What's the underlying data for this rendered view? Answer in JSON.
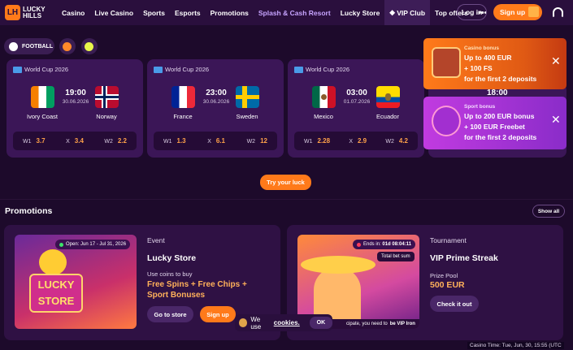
{
  "header": {
    "logo": {
      "mark": "LH",
      "line1": "LUCKY",
      "line2": "HILLS"
    },
    "nav": [
      "Casino",
      "Live Casino",
      "Sports",
      "Esports",
      "Promotions",
      "Splash & Cash Resort",
      "Lucky Store",
      "VIP Club",
      "Top offers"
    ],
    "more": "•••",
    "login": "Log in",
    "signup": "Sign up"
  },
  "sports": {
    "football": "FOOTBALL"
  },
  "matches": [
    {
      "league": "World Cup 2026",
      "time": "19:00",
      "date": "30.06.2026",
      "home": "Ivory Coast",
      "away": "Norway",
      "w1_label": "W1",
      "w1": "3.7",
      "x_label": "X",
      "x": "3.4",
      "w2_label": "W2",
      "w2": "2.2"
    },
    {
      "league": "World Cup 2026",
      "time": "23:00",
      "date": "30.06.2026",
      "home": "France",
      "away": "Sweden",
      "w1_label": "W1",
      "w1": "1.3",
      "x_label": "X",
      "x": "6.1",
      "w2_label": "W2",
      "w2": "12"
    },
    {
      "league": "World Cup 2026",
      "time": "03:00",
      "date": "01.07.2026",
      "home": "Mexico",
      "away": "Ecuador",
      "w1_label": "W1",
      "w1": "2.28",
      "x_label": "X",
      "x": "2.9",
      "w2_label": "W2",
      "w2": "4.2"
    }
  ],
  "peek_time": "18:00",
  "toasts": [
    {
      "kind": "Casino bonus",
      "line1": "Up to 400 EUR",
      "line2": "+ 100 FS",
      "line3": "for the first 2 deposits"
    },
    {
      "kind": "Sport bonus",
      "line1": "Up to 200 EUR bonus",
      "line2": "+ 100 EUR Freebet",
      "line3": "for the first 2 deposits"
    }
  ],
  "try_luck": "Try your luck",
  "promotions": {
    "title": "Promotions",
    "show_all": "Show all",
    "store": {
      "badge": "Open: Jun 17 - Jul 31, 2026",
      "sign1": "LUCKY",
      "sign2": "STORE",
      "kind": "Event",
      "name": "Lucky Store",
      "desc": "Use coins to buy",
      "highlight": "Free Spins + Free Chips + Sport Bonuses",
      "btn_store": "Go to store",
      "btn_signup": "Sign up"
    },
    "streak": {
      "badge_label": "Ends in:",
      "badge_value": "01d 08:04:11",
      "bet_sum": "Total bet sum",
      "vip_note": "cipate, you need to",
      "vip_level": "be VIP Iron",
      "kind": "Tournament",
      "name": "VIP Prime Streak",
      "sub": "Prize Pool",
      "value": "500 EUR",
      "btn": "Check it out"
    }
  },
  "cookie": {
    "text": "We use",
    "link": "cookies.",
    "ok": "OK"
  },
  "casino_time": "Casino Time: Tue, Jun, 30, 15:55 (UTC"
}
